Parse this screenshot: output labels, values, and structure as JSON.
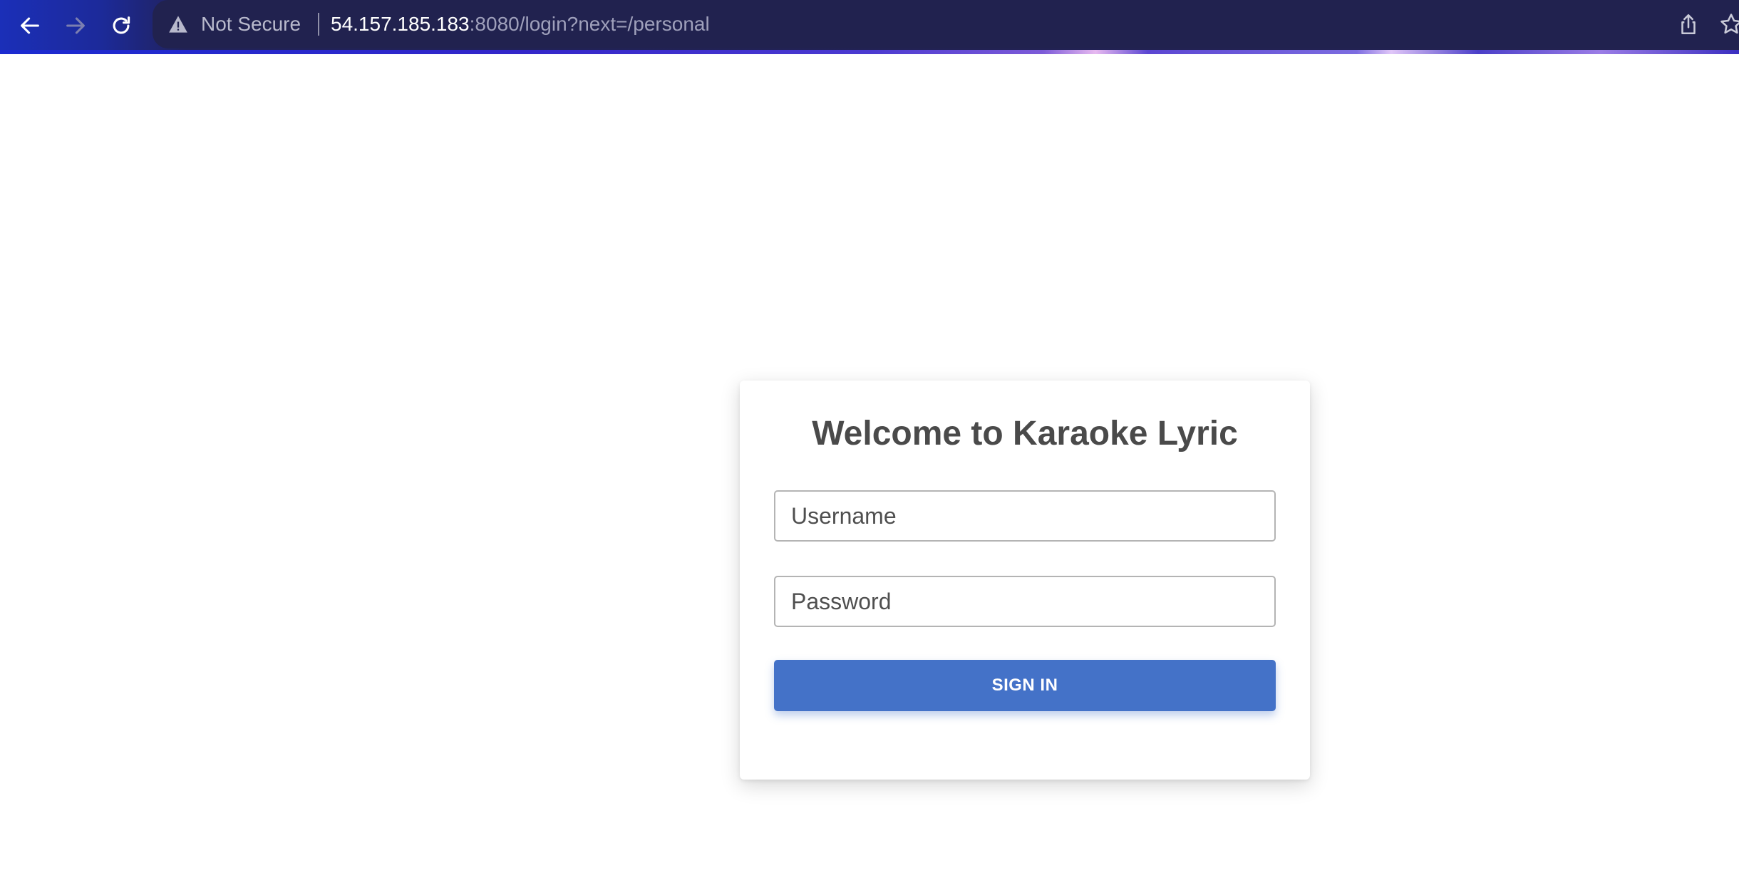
{
  "browser": {
    "security_label": "Not Secure",
    "url_host": "54.157.185.183",
    "url_rest": ":8080/login?next=/personal",
    "icons": [
      "back-icon",
      "forward-icon",
      "reload-icon",
      "warning-icon",
      "share-icon",
      "bookmark-star-icon"
    ]
  },
  "login": {
    "title": "Welcome to Karaoke Lyric",
    "username_placeholder": "Username",
    "password_placeholder": "Password",
    "submit_label": "SIGN IN",
    "accent_color": "#4472c8"
  }
}
